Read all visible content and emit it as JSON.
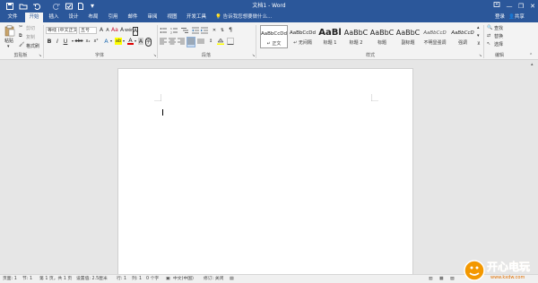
{
  "app": {
    "title": "文档1 - Word"
  },
  "quick_access": {
    "save_icon": "save-icon",
    "folder_icon": "folder-icon",
    "undo_icon": "undo-icon",
    "redo_icon": "redo-icon"
  },
  "window": {
    "minimize": "—",
    "restore": "❐",
    "close": "✕"
  },
  "tabs": [
    {
      "label": "文件"
    },
    {
      "label": "开始"
    },
    {
      "label": "插入"
    },
    {
      "label": "设计"
    },
    {
      "label": "布局"
    },
    {
      "label": "引用"
    },
    {
      "label": "邮件"
    },
    {
      "label": "审阅"
    },
    {
      "label": "视图"
    },
    {
      "label": "开发工具"
    }
  ],
  "tell_me": "告诉我您想要做什么...",
  "account": {
    "signin": "登录",
    "share": "共享"
  },
  "clipboard": {
    "paste": "粘贴",
    "cut": "剪切",
    "copy": "复制",
    "format_painter": "格式刷",
    "label": "剪贴板"
  },
  "font": {
    "family": "等线 (中文正文)",
    "size": "五号",
    "label": "字体",
    "bold": "B",
    "italic": "I",
    "underline": "U",
    "strike": "abc",
    "sub": "x₂",
    "sup": "x²",
    "grow": "A",
    "shrink": "A",
    "clear": "A",
    "wen": "wén",
    "char_border": "A",
    "highlight": "ab",
    "color": "A",
    "case": "Aa",
    "phonetic": "A",
    "enclose": "字"
  },
  "paragraph": {
    "label": "段落"
  },
  "styles": {
    "label": "样式",
    "items": [
      {
        "sample": "AaBbCcDd",
        "name": "↵ 正文"
      },
      {
        "sample": "AaBbCcDd",
        "name": "↵ 无间隔"
      },
      {
        "sample": "AaBl",
        "name": "标题 1"
      },
      {
        "sample": "AaBbC",
        "name": "标题 2"
      },
      {
        "sample": "AaBbC",
        "name": "标题"
      },
      {
        "sample": "AaBbC",
        "name": "副标题"
      },
      {
        "sample": "AaBbCcD",
        "name": "不明显强调"
      },
      {
        "sample": "AaBbCcD",
        "name": "强调"
      }
    ]
  },
  "editing": {
    "find": "查找",
    "replace": "替换",
    "select": "选择",
    "label": "编辑"
  },
  "status": {
    "page": "页面: 1",
    "section": "节: 1",
    "page_of": "第 1 页，共 1 页",
    "position": "设置值: 2.5厘米",
    "line": "行: 1",
    "column": "列: 1",
    "words": "0 个字",
    "lang": "中文(中国)",
    "track": "修订: 关闭"
  },
  "watermark": {
    "text": "开心电玩",
    "sub": "www.kxdw.com"
  }
}
